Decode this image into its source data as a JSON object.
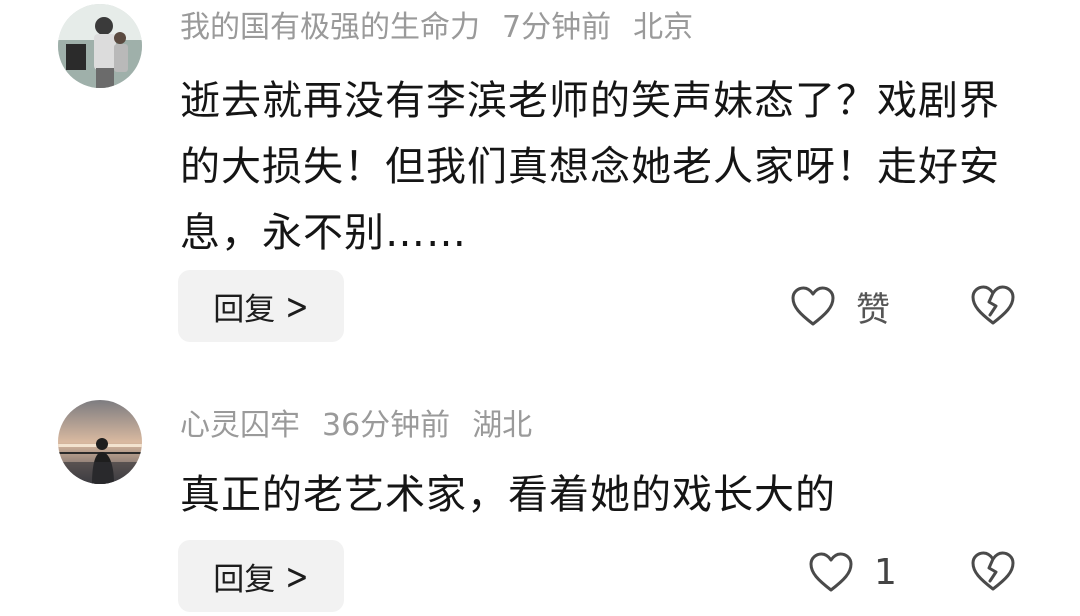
{
  "comments": [
    {
      "username": "我的国有极强的生命力",
      "time": "7分钟前",
      "location": "北京",
      "text": "逝去就再没有李滨老师的笑声妹态了？戏剧界的大损失！但我们真想念她老人家呀！走好安息，永不别……",
      "reply_label": "回复",
      "like_label": "赞"
    },
    {
      "username": "心灵囚牢",
      "time": "36分钟前",
      "location": "湖北",
      "text": "真正的老艺术家，看着她的戏长大的",
      "reply_label": "回复",
      "like_label": "1"
    }
  ],
  "icons": {
    "reply_chevron": "chevron-right-icon",
    "like": "heart-outline-icon",
    "dislike": "broken-heart-icon"
  },
  "colors": {
    "meta_text": "#9a9a9a",
    "body_text": "#151515",
    "reply_bg": "#f2f2f2",
    "icon_stroke": "#4a4a4a"
  }
}
